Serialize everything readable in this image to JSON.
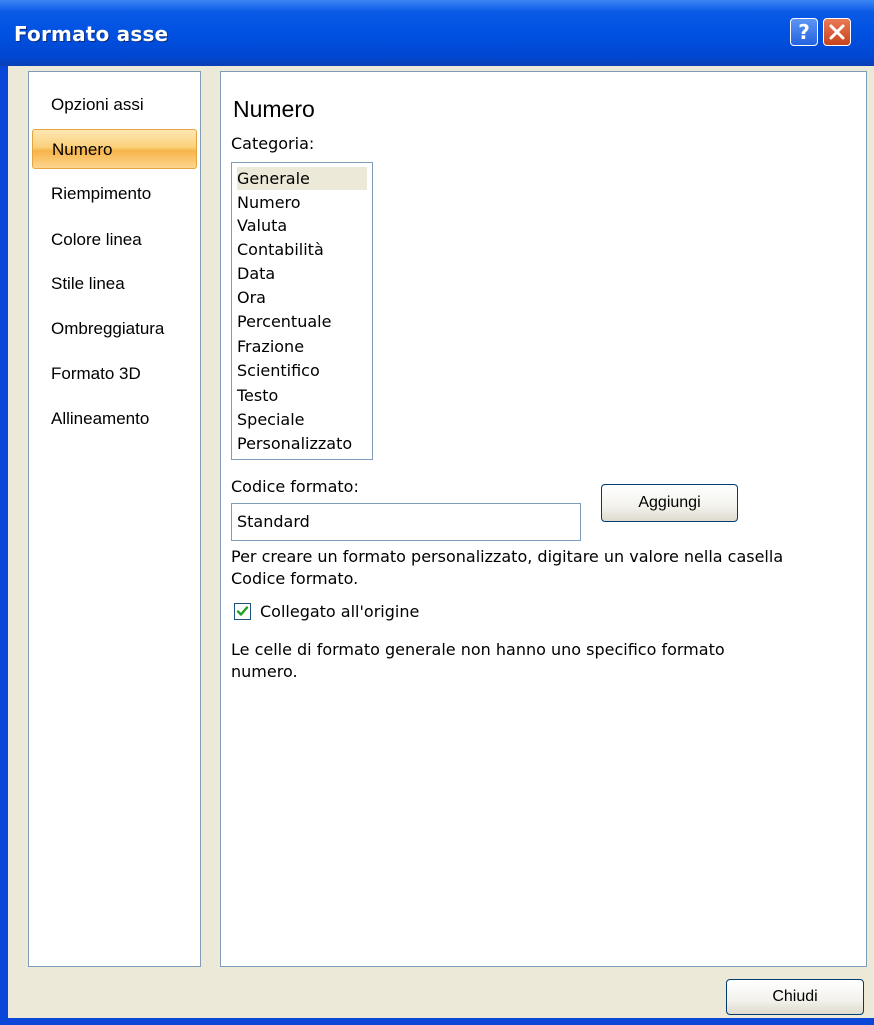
{
  "window": {
    "title": "Formato asse",
    "help_glyph": "?",
    "close_glyph": "✕"
  },
  "sidebar": {
    "items": [
      {
        "label": "Opzioni assi",
        "active": false
      },
      {
        "label": "Numero",
        "active": true
      },
      {
        "label": "Riempimento",
        "active": false
      },
      {
        "label": "Colore linea",
        "active": false
      },
      {
        "label": "Stile linea",
        "active": false
      },
      {
        "label": "Ombreggiatura",
        "active": false
      },
      {
        "label": "Formato 3D",
        "active": false
      },
      {
        "label": "Allineamento",
        "active": false
      }
    ]
  },
  "main": {
    "title": "Numero",
    "category_label": "Categoria:",
    "categories": [
      "Generale",
      "Numero",
      "Valuta",
      "Contabilità",
      "Data",
      "Ora",
      "Percentuale",
      "Frazione",
      "Scientifico",
      "Testo",
      "Speciale",
      "Personalizzato"
    ],
    "selected_category": "Generale",
    "format_code_label": "Codice formato:",
    "format_code_value": "Standard",
    "add_button": "Aggiungi",
    "hint_line1": "Per creare un formato personalizzato, digitare un valore nella casella",
    "hint_line2": "Codice formato.",
    "linked_checkbox_label": "Collegato all'origine",
    "linked_checked": true,
    "description_line1": "Le celle di formato generale non hanno uno specifico formato",
    "description_line2": "numero."
  },
  "footer": {
    "close_button": "Chiudi"
  },
  "colors": {
    "titlebar": "#0054e3",
    "dialog_bg": "#ece9d8",
    "active_tab": "#fbd07a",
    "check": "#21a121"
  }
}
